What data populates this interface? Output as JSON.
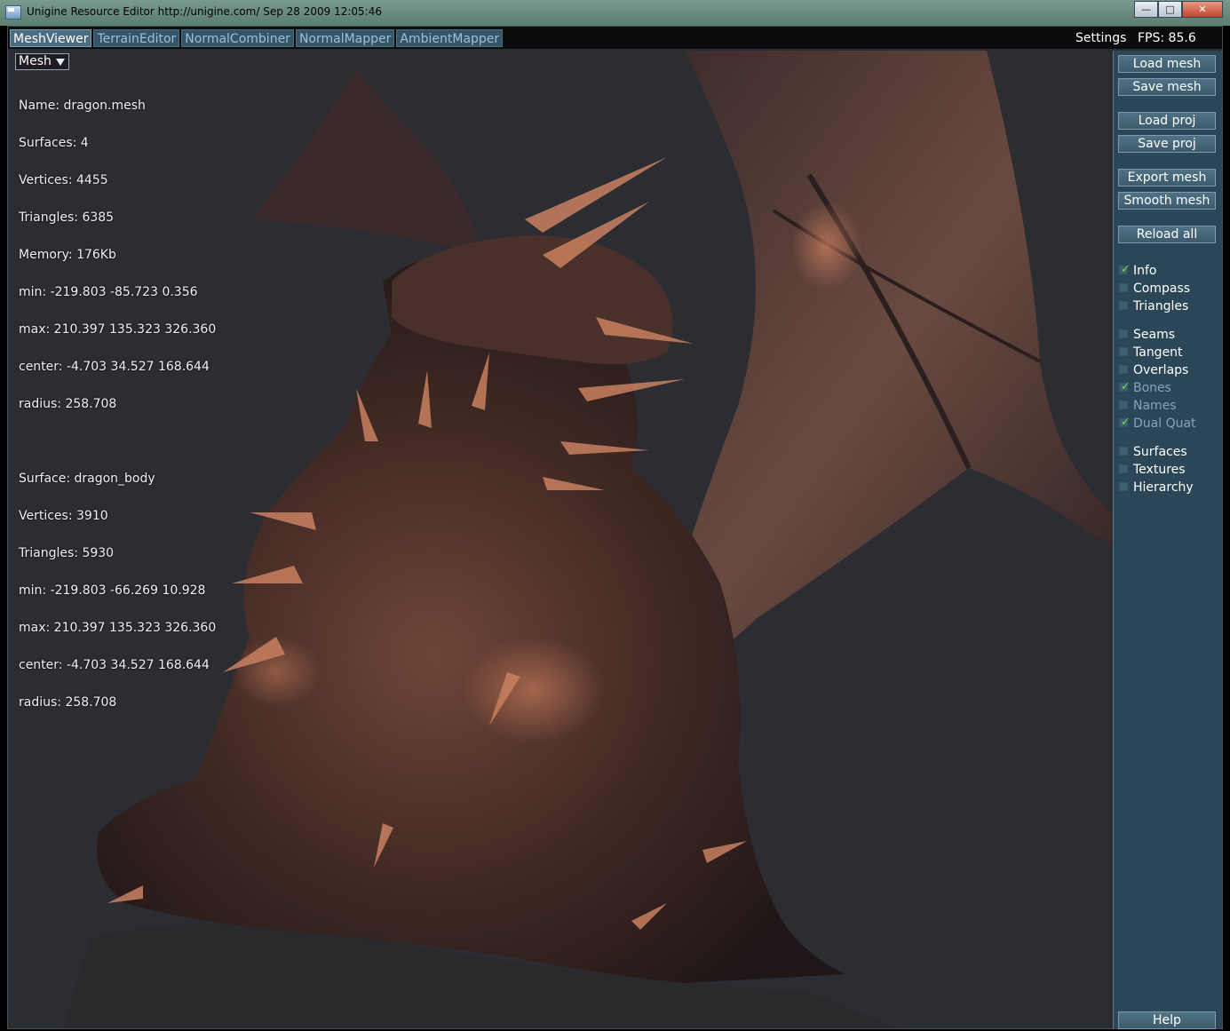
{
  "window": {
    "title": "Unigine Resource Editor http://unigine.com/ Sep 28 2009 12:05:46",
    "minimize_label": "—",
    "maximize_label": "□",
    "close_label": "✕"
  },
  "tabs": [
    {
      "label": "MeshViewer",
      "active": true
    },
    {
      "label": "TerrainEditor",
      "active": false
    },
    {
      "label": "NormalCombiner",
      "active": false
    },
    {
      "label": "NormalMapper",
      "active": false
    },
    {
      "label": "AmbientMapper",
      "active": false
    }
  ],
  "header": {
    "settings_label": "Settings",
    "fps_label": "FPS: 85.6"
  },
  "viewport": {
    "mode_select": "Mesh",
    "info_lines": [
      "Name: dragon.mesh",
      "Surfaces: 4",
      "Vertices: 4455",
      "Triangles: 6385",
      "Memory: 176Kb",
      "min: -219.803 -85.723 0.356",
      "max: 210.397 135.323 326.360",
      "center: -4.703 34.527 168.644",
      "radius: 258.708",
      "",
      "Surface: dragon_body",
      "Vertices: 3910",
      "Triangles: 5930",
      "min: -219.803 -66.269 10.928",
      "max: 210.397 135.323 326.360",
      "center: -4.703 34.527 168.644",
      "radius: 258.708"
    ]
  },
  "panel": {
    "buttons": {
      "load_mesh": "Load mesh",
      "save_mesh": "Save mesh",
      "load_proj": "Load proj",
      "save_proj": "Save proj",
      "export_mesh": "Export mesh",
      "smooth_mesh": "Smooth mesh",
      "reload_all": "Reload all",
      "help": "Help"
    },
    "checkboxes": {
      "info": {
        "label": "Info",
        "checked": true
      },
      "compass": {
        "label": "Compass",
        "checked": false
      },
      "triangles": {
        "label": "Triangles",
        "checked": false
      },
      "seams": {
        "label": "Seams",
        "checked": false
      },
      "tangent": {
        "label": "Tangent",
        "checked": false
      },
      "overlaps": {
        "label": "Overlaps",
        "checked": false
      },
      "bones": {
        "label": "Bones",
        "checked": true
      },
      "names": {
        "label": "Names",
        "checked": false
      },
      "dual_quat": {
        "label": "Dual Quat",
        "checked": true
      },
      "surfaces": {
        "label": "Surfaces",
        "checked": false
      },
      "textures": {
        "label": "Textures",
        "checked": false
      },
      "hierarchy": {
        "label": "Hierarchy",
        "checked": false
      }
    }
  }
}
